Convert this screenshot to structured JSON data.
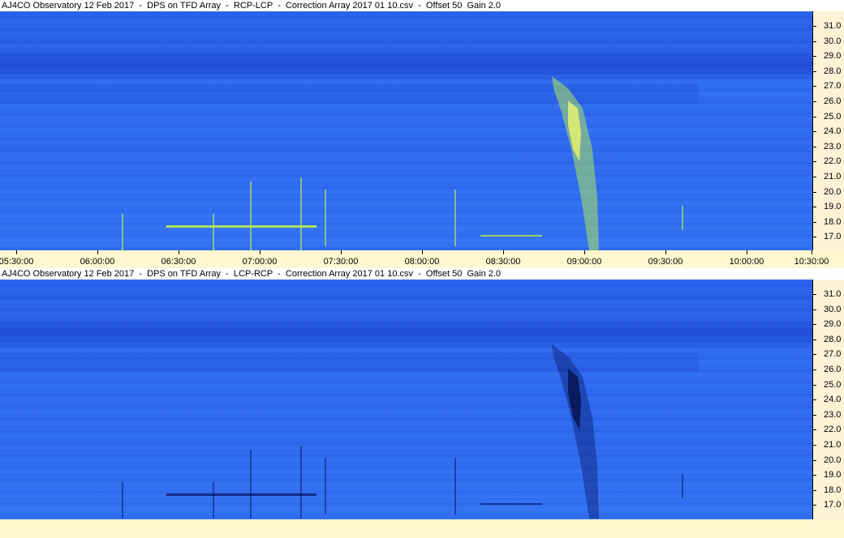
{
  "panels": [
    {
      "title": "AJ4CO Observatory 12 Feb 2017  -  DPS on TFD Array  -  RCP-LCP  -  Correction Array 2017 01 10.csv  -  Offset 50  Gain 2.0",
      "polarity": "RCP-LCP",
      "burst_color": "#c8ff3c",
      "burst_core_color": "#ffff66"
    },
    {
      "title": "AJ4CO Observatory 12 Feb 2017  -  DPS on TFD Array  -  LCP-RCP  -  Correction Array 2017 01 10.csv  -  Offset 50  Gain 2.0",
      "polarity": "LCP-RCP",
      "burst_color": "#0a1a6e",
      "burst_core_color": "#020a3a"
    }
  ],
  "frequency_axis": {
    "unit": "MHz",
    "labels": [
      "31.0",
      "30.0",
      "29.0",
      "28.0",
      "27.0",
      "26.0",
      "25.0",
      "24.0",
      "23.0",
      "22.0",
      "21.0",
      "20.0",
      "19.0",
      "18.0",
      "17.0"
    ]
  },
  "time_axis": {
    "labels": [
      "05:30:00",
      "06:00:00",
      "06:30:00",
      "07:00:00",
      "07:30:00",
      "08:00:00",
      "08:30:00",
      "09:00:00",
      "09:30:00",
      "10:00:00",
      "10:30:00"
    ]
  },
  "colors": {
    "background_blue": "#2e69ee",
    "axis_bg": "#fff2d6",
    "strip_bg": "#fff8cf"
  }
}
